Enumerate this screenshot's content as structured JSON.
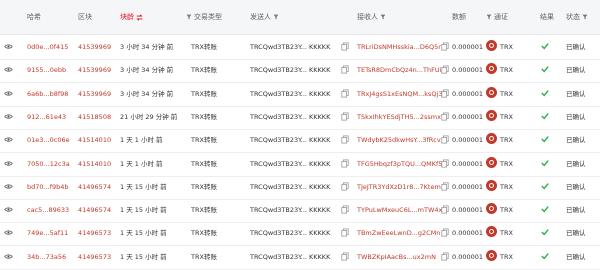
{
  "header": {
    "hash": "哈希",
    "block": "区块",
    "age": "块龄",
    "type": "交易类型",
    "from": "发送人",
    "to": "接收人",
    "amount": "数额",
    "token": "通证",
    "result": "结果",
    "status": "状态"
  },
  "colors": {
    "accent": "#c0392b",
    "success": "#2bb24c"
  },
  "icons": {
    "view": "eye-icon",
    "filter": "filter-icon",
    "copy": "copy-icon",
    "token": "trx-token-icon",
    "result": "check-icon"
  },
  "rows": [
    {
      "hash": "0d0e...0f415",
      "block": "41539969",
      "age": "3 小时 34 分钟 前",
      "type": "TRX转账",
      "from": "TRCQwd3TB23Y... KKKKK",
      "to": "TRLriDsNMHsskia...D6Q5r",
      "amount": "0.000001",
      "token": "TRX",
      "status": "已确认"
    },
    {
      "hash": "9155...0ebb",
      "block": "41539969",
      "age": "3 小时 34 分钟 前",
      "type": "TRX转账",
      "from": "TRCQwd3TB23Y... KKKKK",
      "to": "TETsR8DmCbQz4n...ThFUi",
      "amount": "0.000001",
      "token": "TRX",
      "status": "已确认"
    },
    {
      "hash": "6a6b...b8f98",
      "block": "41539969",
      "age": "3 小时 34 分钟 前",
      "type": "TRX转账",
      "from": "TRCQwd3TB23Y... KKKKK",
      "to": "TRxJ4gsS1xEsNQM...ksQj3",
      "amount": "0.000001",
      "token": "TRX",
      "status": "已确认"
    },
    {
      "hash": "912...61e43",
      "block": "41518508",
      "age": "21 小时 29 分钟 前",
      "type": "TRX转账",
      "from": "TRCQwd3TB23Y... KKKKK",
      "to": "TSkxIhkYESdjTH5...2ssmx",
      "amount": "0.000001",
      "token": "TRX",
      "status": "已确认"
    },
    {
      "hash": "01e3...0c06e",
      "block": "41514010",
      "age": "1 天 1 小时 前",
      "type": "TRX转账",
      "from": "TRCQwd3TB23Y... KKKKK",
      "to": "TWdybK25dkwHsY...3fRcv",
      "amount": "0.000001",
      "token": "TRX",
      "status": "已确认"
    },
    {
      "hash": "7050...12c3a",
      "block": "41514010",
      "age": "1 天 1 小时 前",
      "type": "TRX转账",
      "from": "TRCQwd3TB23Y... KKKKK",
      "to": "TFG5Hbqzf3pTQU...QMKf5",
      "amount": "0.000001",
      "token": "TRX",
      "status": "已确认"
    },
    {
      "hash": "bd70...f9b4b",
      "block": "41496574",
      "age": "1 天 15 小时 前",
      "type": "TRX转账",
      "from": "TRCQwd3TB23Y... KKKKK",
      "to": "TJeJTR3YdXzD1r8...7Ktem",
      "amount": "0.000001",
      "token": "TRX",
      "status": "已确认"
    },
    {
      "hash": "cac5...89633",
      "block": "41496574",
      "age": "1 天 15 小时 前",
      "type": "TRX转账",
      "from": "TRCQwd3TB23Y... KKKKK",
      "to": "TYPuLwMxeuC6L...mTW4x",
      "amount": "0.000001",
      "token": "TRX",
      "status": "已确认"
    },
    {
      "hash": "749e...5af11",
      "block": "41496573",
      "age": "1 天 15 小时 前",
      "type": "TRX转账",
      "from": "TRCQwd3TB23Y... KKKKK",
      "to": "TBmZwEeeLwnD...g2CMn",
      "amount": "0.000001",
      "token": "TRX",
      "status": "已确认"
    },
    {
      "hash": "34b...73a56",
      "block": "41496573",
      "age": "1 天 15 小时 前",
      "type": "TRX转账",
      "from": "TRCQwd3TB23Y... KKKKK",
      "to": "TWBZKpIAacBs...ux2mN",
      "amount": "0.000001",
      "token": "TRX",
      "status": "已确认"
    }
  ]
}
